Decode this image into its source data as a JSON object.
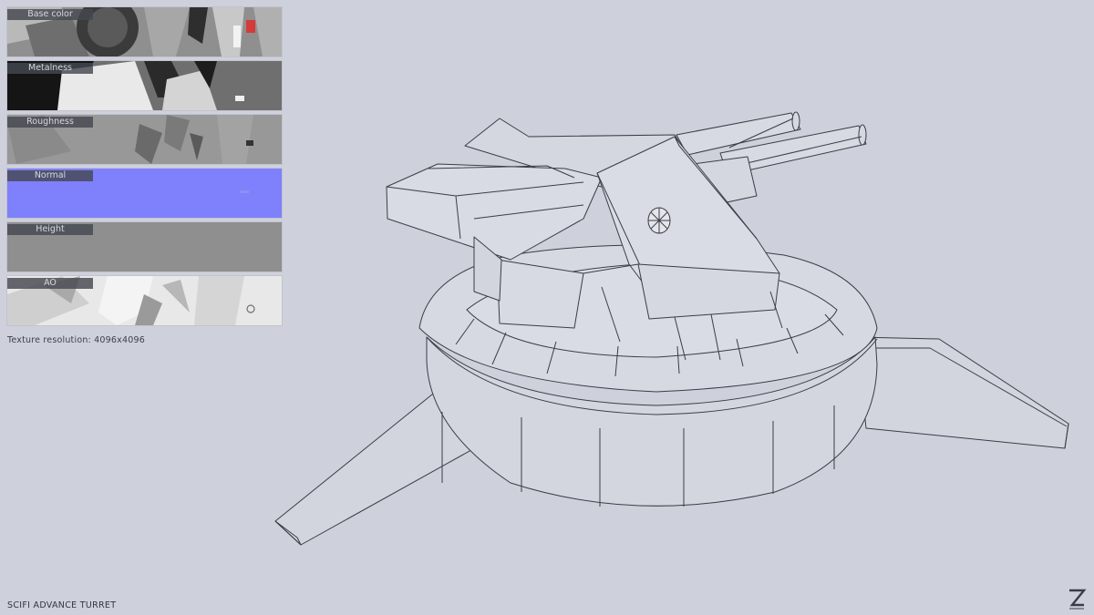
{
  "texture_maps": [
    {
      "label": "Base color",
      "fill": "#8d8d8d"
    },
    {
      "label": "Metalness",
      "fill": "#707070"
    },
    {
      "label": "Roughness",
      "fill": "#979797"
    },
    {
      "label": "Normal",
      "fill": "#7f80fc"
    },
    {
      "label": "Height",
      "fill": "#8f8f8f"
    },
    {
      "label": "AO",
      "fill": "#e6e6e6"
    }
  ],
  "texture_resolution": "Texture resolution: 4096x4096",
  "model_title": "SCIFI ADVANCE TURRET",
  "logo": "Z-logo-icon",
  "colors": {
    "background": "#ced1db",
    "wireframe": "#3a3d46",
    "normal_map": "#7f80fc"
  }
}
